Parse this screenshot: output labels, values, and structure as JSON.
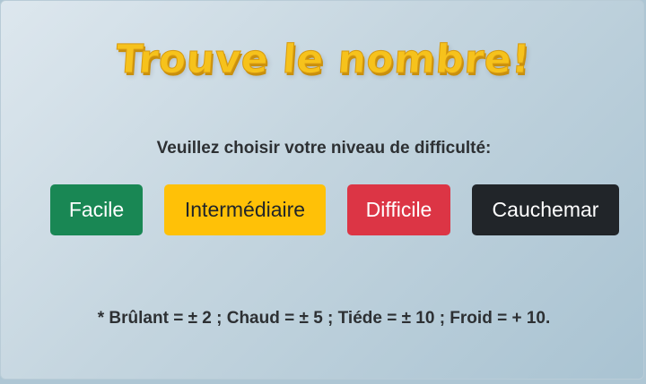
{
  "title": "Trouve le nombre!",
  "prompt": "Veuillez choisir votre niveau de difficulté:",
  "buttons": {
    "easy": "Facile",
    "medium": "Intermédiaire",
    "hard": "Difficile",
    "nightmare": "Cauchemar"
  },
  "legend": "* Brûlant = ± 2 ; Chaud = ± 5 ; Tiéde = ± 10 ; Froid = + 10.",
  "colors": {
    "title": "#f6c21c",
    "easy": "#198754",
    "medium": "#ffc107",
    "hard": "#dc3545",
    "nightmare": "#212529"
  }
}
